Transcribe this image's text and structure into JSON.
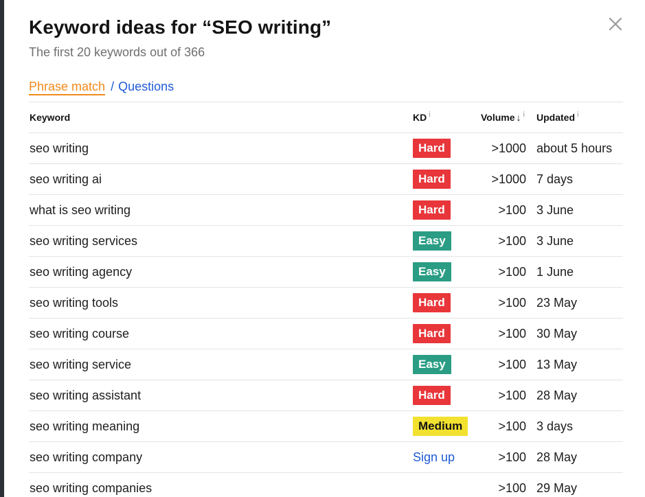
{
  "dialog": {
    "title": "Keyword ideas for “SEO writing”",
    "subtitle": "The first 20 keywords out of 366",
    "close_icon": "close-icon"
  },
  "tabs": {
    "phrase_match": "Phrase match",
    "separator": "/",
    "questions": "Questions"
  },
  "table": {
    "headers": {
      "keyword": "Keyword",
      "kd": "KD",
      "volume": "Volume",
      "updated": "Updated",
      "info_mark": "i",
      "sort_arrow": "↓"
    },
    "rows": [
      {
        "keyword": "seo writing",
        "kd": "Hard",
        "volume": ">1000",
        "updated": "about 5 hours"
      },
      {
        "keyword": "seo writing ai",
        "kd": "Hard",
        "volume": ">1000",
        "updated": "7 days"
      },
      {
        "keyword": "what is seo writing",
        "kd": "Hard",
        "volume": ">100",
        "updated": "3 June"
      },
      {
        "keyword": "seo writing services",
        "kd": "Easy",
        "volume": ">100",
        "updated": "3 June"
      },
      {
        "keyword": "seo writing agency",
        "kd": "Easy",
        "volume": ">100",
        "updated": "1 June"
      },
      {
        "keyword": "seo writing tools",
        "kd": "Hard",
        "volume": ">100",
        "updated": "23 May"
      },
      {
        "keyword": "seo writing course",
        "kd": "Hard",
        "volume": ">100",
        "updated": "30 May"
      },
      {
        "keyword": "seo writing service",
        "kd": "Easy",
        "volume": ">100",
        "updated": "13 May"
      },
      {
        "keyword": "seo writing assistant",
        "kd": "Hard",
        "volume": ">100",
        "updated": "28 May"
      },
      {
        "keyword": "seo writing meaning",
        "kd": "Medium",
        "volume": ">100",
        "updated": "3 days"
      },
      {
        "keyword": "seo writing company",
        "kd": "Sign up",
        "volume": ">100",
        "updated": "28 May"
      },
      {
        "keyword": "seo writing companies",
        "kd": "",
        "volume": ">100",
        "updated": "29 May"
      }
    ]
  },
  "colors": {
    "hard": "#e8363a",
    "easy": "#2a9d84",
    "medium": "#f2e12f",
    "accent_orange": "#f28a1c",
    "link_blue": "#1f5ad6"
  }
}
